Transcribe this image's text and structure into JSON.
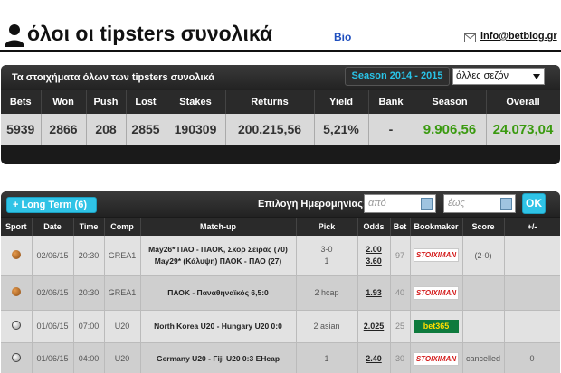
{
  "header": {
    "title": "όλοι οι tipsters συνολικά",
    "bio_link": "Bio",
    "email": "info@betblog.gr",
    "user_icon": "user-silhouette-icon",
    "mail_icon": "envelope-icon"
  },
  "stats": {
    "title": "Τα στοιχήματα όλων των tipsters συνολικά",
    "season_label": "Season 2014 - 2015",
    "season_select": "άλλες σεζόν",
    "columns": [
      "Bets",
      "Won",
      "Push",
      "Lost",
      "Stakes",
      "Returns",
      "Yield",
      "Bank",
      "Season",
      "Overall"
    ],
    "values": [
      "5939",
      "2866",
      "208",
      "2855",
      "190309",
      "200.215,56",
      "5,21%",
      "-",
      "9.906,56",
      "24.073,04"
    ]
  },
  "bets": {
    "long_term_button": "+ Long Term (6)",
    "date_label": "Επιλογή Ημερομηνίας:",
    "date_from_placeholder": "από",
    "date_to_placeholder": "έως",
    "ok_button": "OK",
    "columns": [
      "Sport",
      "Date",
      "Time",
      "Comp",
      "Match-up",
      "Pick",
      "Odds",
      "Bet",
      "Bookmaker",
      "Score",
      "+/-"
    ],
    "rows": [
      {
        "sport": "basketball",
        "date": "02/06/15",
        "time": "20:30",
        "comp": "GREA1",
        "matchup_1": "May26* ΠΑΟ - ΠΑΟΚ, Σκορ Σειράς (70)",
        "matchup_2": "May29* (Κάλυψη) ΠΑΟΚ - ΠΑΟ (27)",
        "pick_1": "3-0",
        "pick_2": "1",
        "odds_1": "2.00",
        "odds_2": "3.60",
        "bet": "97",
        "bookmaker": "STOIXIMAN",
        "score": "(2-0)",
        "result": ""
      },
      {
        "sport": "basketball",
        "date": "02/06/15",
        "time": "20:30",
        "comp": "GREA1",
        "matchup_1": "ΠΑΟΚ - Παναθηναϊκός 6,5:0",
        "pick_1": "2 hcap",
        "odds_1": "1.93",
        "bet": "40",
        "bookmaker": "STOIXIMAN",
        "score": "",
        "result": ""
      },
      {
        "sport": "soccer",
        "date": "01/06/15",
        "time": "07:00",
        "comp": "U20",
        "matchup_1": "North Korea U20 - Hungary U20 0:0",
        "pick_1": "2 asian",
        "odds_1": "2.025",
        "bet": "25",
        "bookmaker": "bet365",
        "score": "",
        "result": ""
      },
      {
        "sport": "soccer",
        "date": "01/06/15",
        "time": "04:00",
        "comp": "U20",
        "matchup_1": "Germany U20 - Fiji U20 0:3 EHcap",
        "pick_1": "1",
        "odds_1": "2.40",
        "bet": "30",
        "bookmaker": "STOIXIMAN",
        "score": "cancelled",
        "result": "0"
      }
    ]
  },
  "colors": {
    "accent_cyan": "#2fc3e6",
    "positive_green": "#3a9a10",
    "panel_dark": "#1a1a1a"
  }
}
